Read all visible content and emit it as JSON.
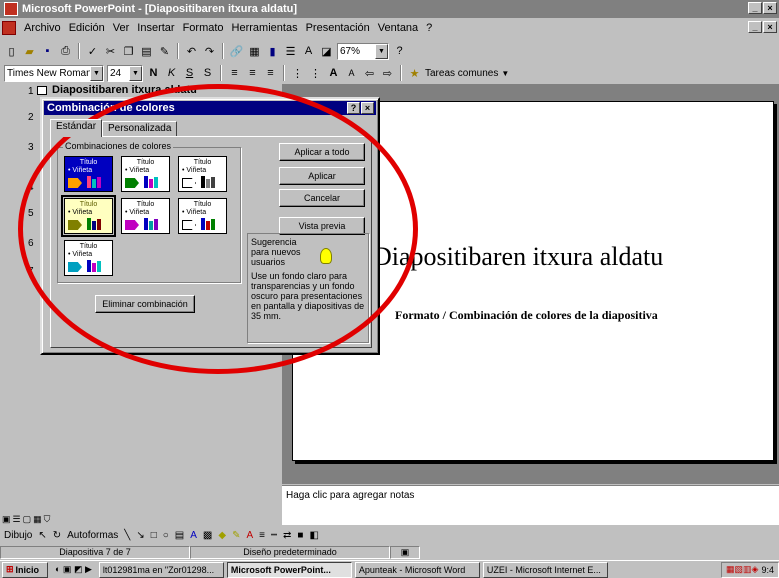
{
  "window": {
    "title": "Microsoft PowerPoint - [Diapositibaren itxura aldatu]",
    "controls": [
      "_",
      "×"
    ]
  },
  "menu": [
    "Archivo",
    "Edición",
    "Ver",
    "Insertar",
    "Formato",
    "Herramientas",
    "Presentación",
    "Ventana",
    "?"
  ],
  "toolbar_standard": {
    "zoom": "67%"
  },
  "toolbar_format": {
    "font": "Times New Roman",
    "size": "24",
    "tasks": "Tareas comunes"
  },
  "outline": {
    "slide_numbers": [
      "1",
      "2",
      "3",
      "4",
      "5",
      "6",
      "7"
    ],
    "slide1_title": "Diapositibaren itxura aldatu"
  },
  "slide": {
    "title": "Diapositibaren itxura aldatu",
    "subtitle": "Formato / Combinación de colores de la diapositiva"
  },
  "notes_placeholder": "Haga clic para agregar notas",
  "dialog": {
    "title": "Combinación de colores",
    "tabs": [
      "Estándar",
      "Personalizada"
    ],
    "group_label": "Combinaciones de colores",
    "swatch_title": "Título",
    "swatch_bullet": "• Viñeta",
    "buttons": {
      "apply_all": "Aplicar a todo",
      "apply": "Aplicar",
      "cancel": "Cancelar",
      "preview": "Vista previa",
      "delete_scheme": "Eliminar combinación"
    },
    "tip_heading": "Sugerencia para nuevos usuarios",
    "tip_text": "Use un fondo claro para transparencias y un fondo oscuro para presentaciones en pantalla y diapositivas de 35 mm."
  },
  "drawbar": {
    "draw": "Dibujo",
    "autoshapes": "Autoformas"
  },
  "status": {
    "slide": "Diapositiva 7 de 7",
    "design": "Diseño predeterminado"
  },
  "taskbar": {
    "start": "Inicio",
    "tasks": [
      "lt012981ma en \"Zor01298...",
      "Microsoft PowerPoint...",
      "Apunteak - Microsoft Word",
      "UZEI - Microsoft Internet E..."
    ],
    "clock": "9:4"
  },
  "colors": {
    "titlebar": "#808080",
    "dialog_title": "#000080",
    "annotation": "#e00000"
  }
}
